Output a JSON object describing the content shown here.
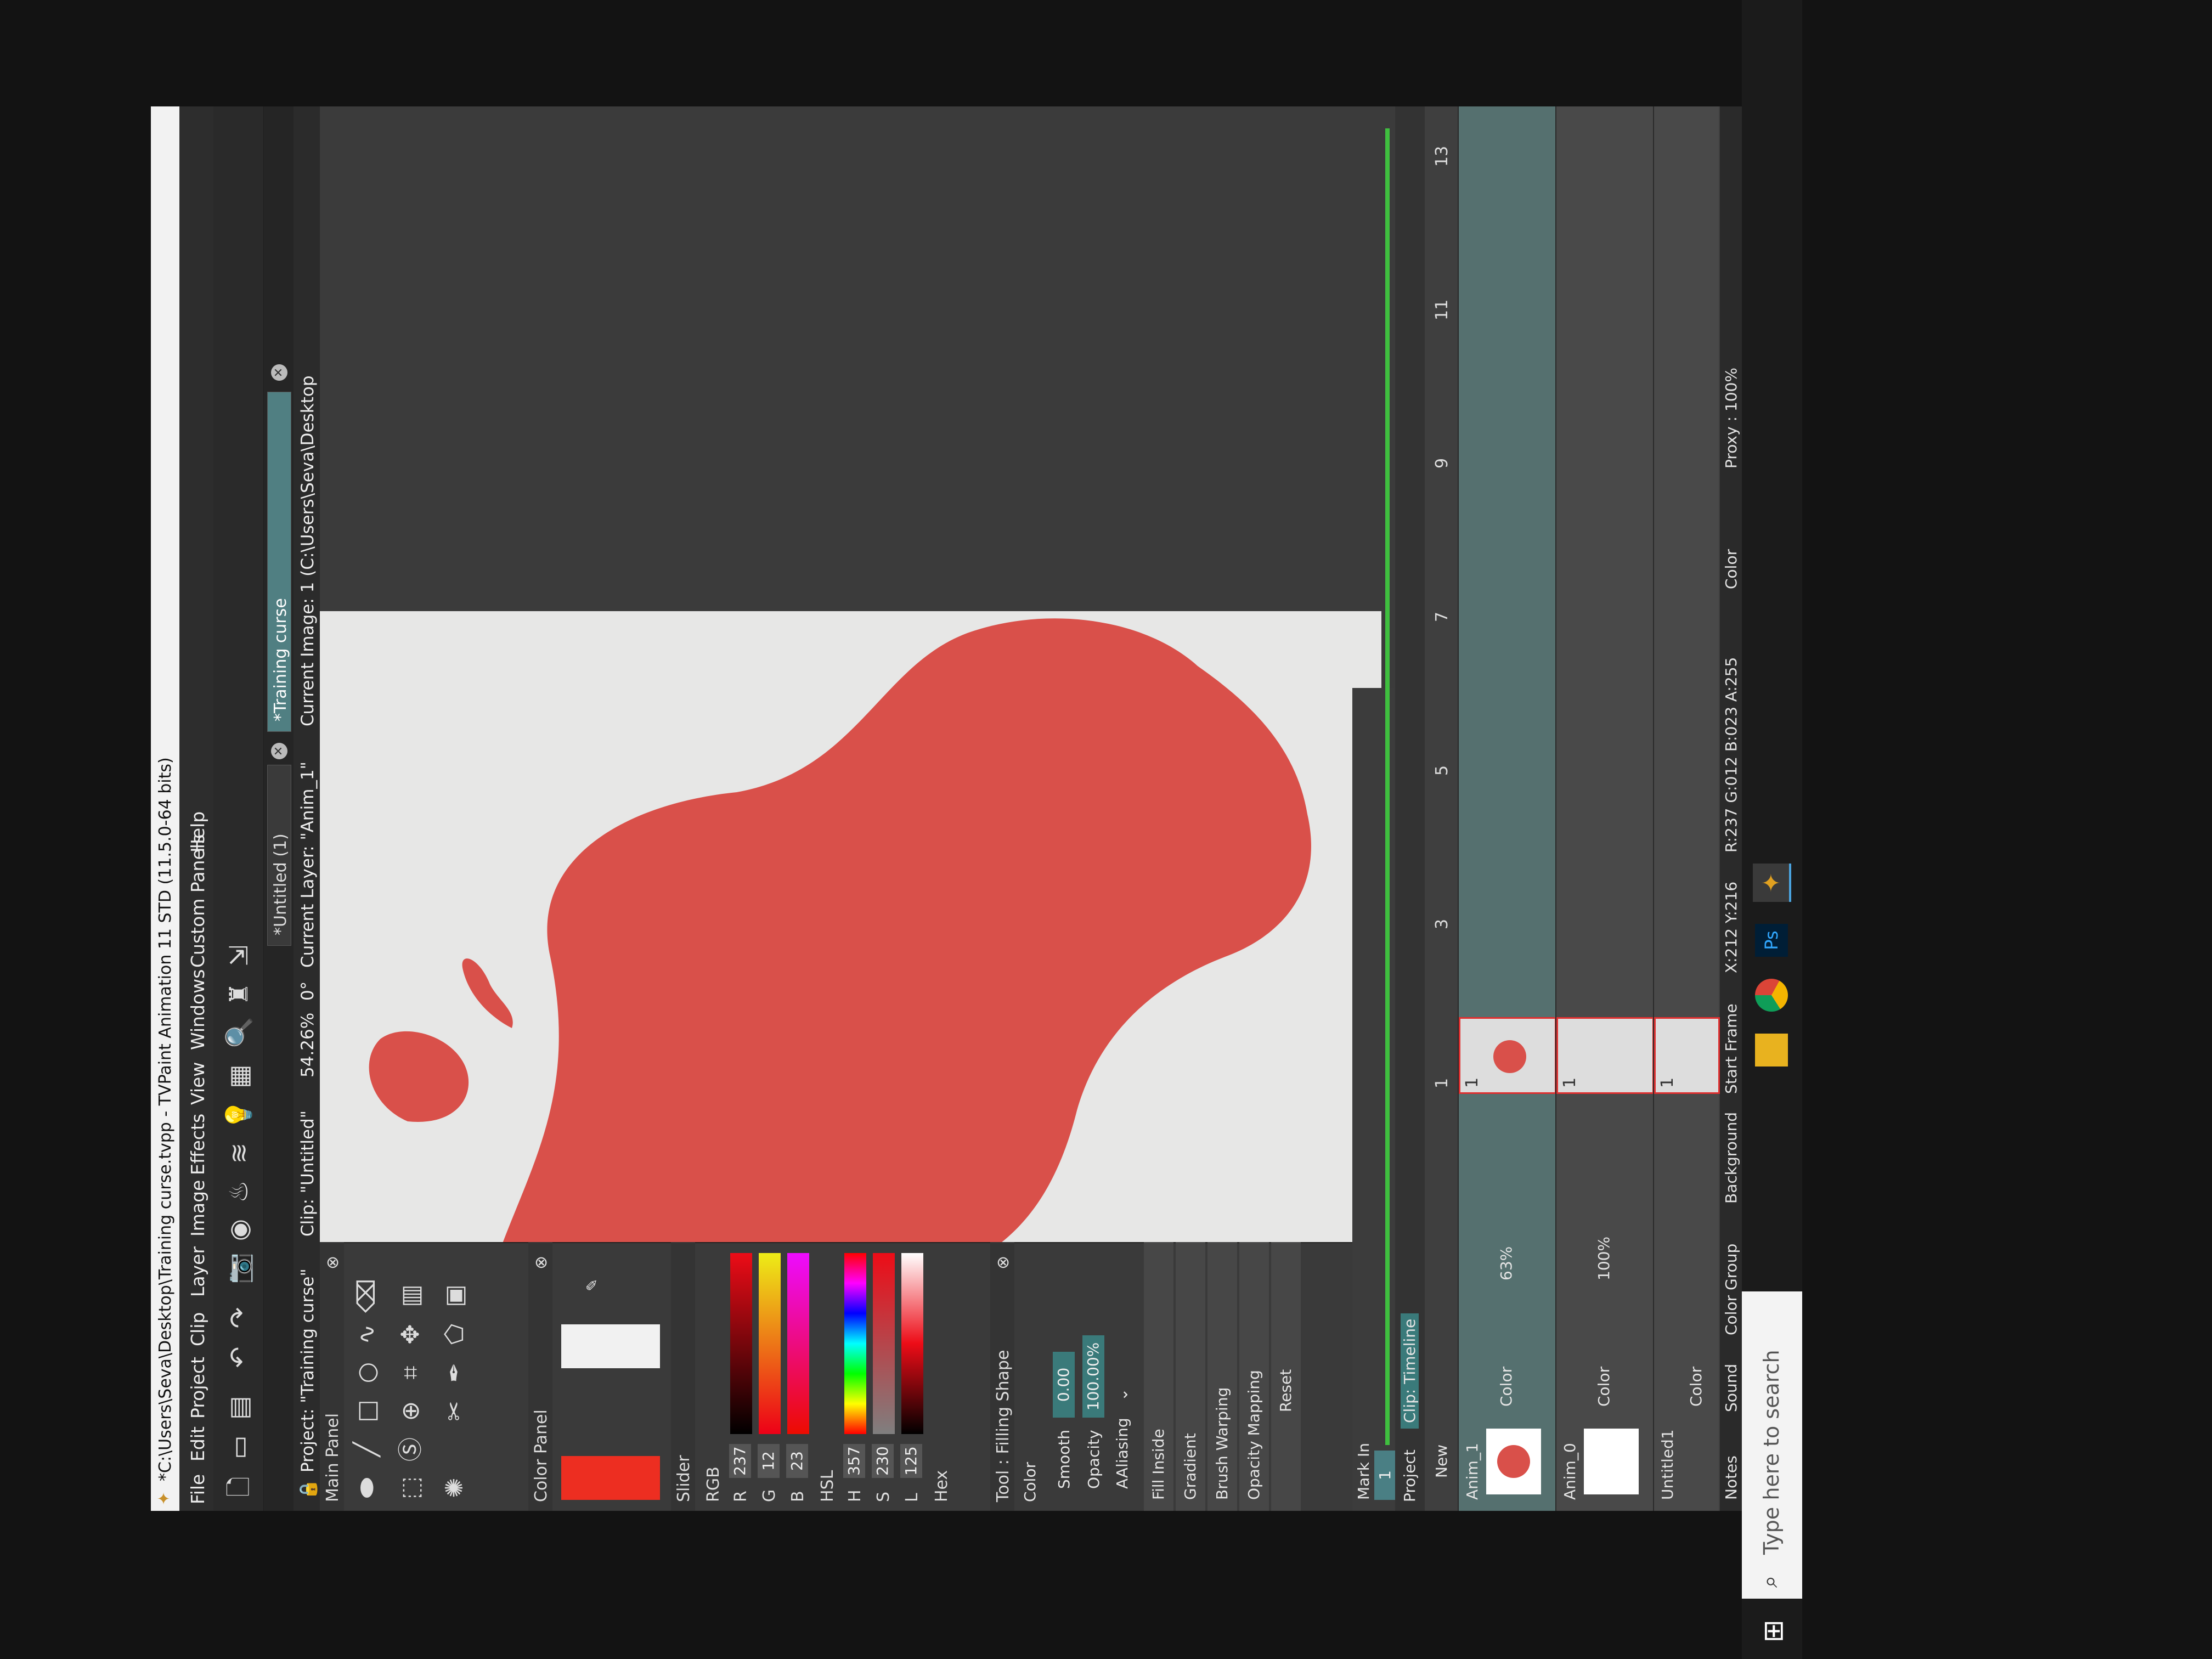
{
  "window": {
    "title": "*C:\\Users\\Seva\\Desktop\\Training curse.tvpp - TVPaint Animation 11 STD (11.5.0-64 bits)"
  },
  "menu": [
    "File",
    "Edit",
    "Project",
    "Clip",
    "Layer",
    "Image",
    "Effects",
    "View",
    "Windows",
    "Custom Panels",
    "Help"
  ],
  "tabs": [
    {
      "label": "*Untitled (1)"
    },
    {
      "label": "*Training curse"
    }
  ],
  "info": {
    "project": "Project: \"Training curse\"",
    "clip": "Clip: \"Untitled\"",
    "zoom": "54.26%",
    "angle": "0°",
    "layer": "Current Layer: \"Anim_1\"",
    "image": "Current Image: 1 (C:\\Users\\Seva\\Desktop"
  },
  "panels": {
    "main_panel": "Main Panel",
    "color_panel": "Color Panel",
    "slider": "Slider",
    "tool": "Tool : Filling Shape"
  },
  "color_slider": {
    "rgb_label": "RGB",
    "r_label": "R",
    "r": "237",
    "g_label": "G",
    "g": "12",
    "b_label": "B",
    "b": "23",
    "hsl_label": "HSL",
    "h_label": "H",
    "h": "357",
    "s_label": "S",
    "s": "230",
    "l_label": "L",
    "l": "125",
    "hex_label": "Hex",
    "current_color": "#ed0c17"
  },
  "tool_options": {
    "color_label": "Color",
    "smooth_label": "Smooth",
    "smooth": "0.00",
    "opacity_label": "Opacity",
    "opacity": "100.00%",
    "aaliasing_label": "AAliasing",
    "buttons": [
      "Fill Inside",
      "Gradient",
      "Brush Warping",
      "Opacity Mapping",
      "Reset"
    ]
  },
  "markin": {
    "label": "Mark In",
    "value": "1"
  },
  "timeline_tabs": [
    "Project",
    "Clip: Timeline"
  ],
  "timeline": {
    "new_label": "New",
    "layers": [
      {
        "name": "Anim_1",
        "mode": "Color",
        "opacity": "63%",
        "frame": "1"
      },
      {
        "name": "Anim_0",
        "mode": "Color",
        "opacity": "100%",
        "frame": "1"
      },
      {
        "name": "Untitled1",
        "mode": "Color",
        "opacity": "",
        "frame": "1"
      }
    ],
    "notes": "Notes",
    "sound": "Sound",
    "color_group": "Color Group",
    "background": "Background",
    "start_frame": "Start Frame",
    "color_footer": "Color",
    "proxy": "Proxy : 100%",
    "frames": [
      "1",
      "3",
      "5",
      "7",
      "9",
      "11",
      "13"
    ]
  },
  "status": {
    "coords": "X:212  Y:216",
    "rgba": "R:237 G:012 B:023 A:255"
  },
  "taskbar": {
    "search_placeholder": "Type here to search"
  },
  "colors": {
    "blob": "#d9504a",
    "canvas": "#e7e7e6",
    "accent_green": "#3fbf3f",
    "selection_red": "#e03030"
  }
}
